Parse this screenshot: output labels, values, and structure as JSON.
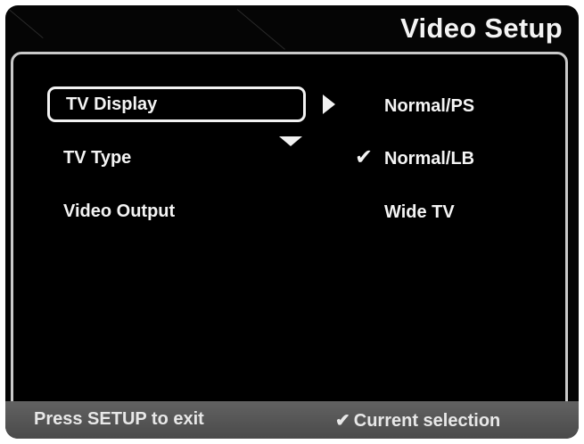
{
  "header": {
    "title": "Video Setup"
  },
  "menu": {
    "items": [
      {
        "label": "TV Display",
        "selected": true
      },
      {
        "label": "TV Type",
        "selected": false
      },
      {
        "label": "Video Output",
        "selected": false
      }
    ]
  },
  "options": {
    "items": [
      {
        "label": "Normal/PS",
        "current": false
      },
      {
        "label": "Normal/LB",
        "current": true
      },
      {
        "label": "Wide TV",
        "current": false
      }
    ]
  },
  "footer": {
    "exit_hint": "Press SETUP to exit",
    "legend_label": "Current selection"
  },
  "icons": {
    "right_arrow": "triangle-right",
    "down_arrow": "triangle-down",
    "checkmark": "check-mark"
  },
  "colors": {
    "background": "#000000",
    "text": "#f4f4f4",
    "frame": "#c9c9c9",
    "footer": "#555555"
  }
}
